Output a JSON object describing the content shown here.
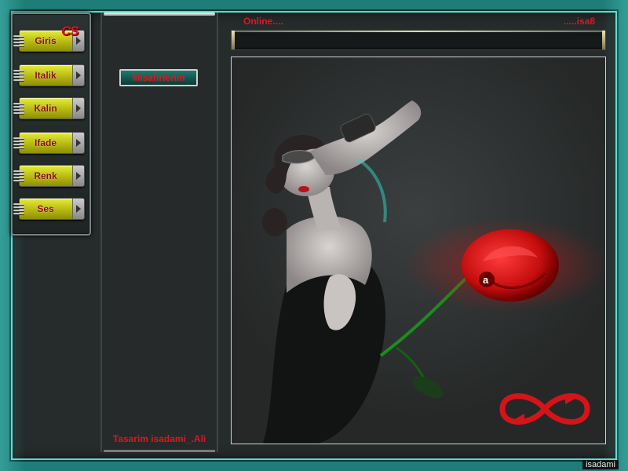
{
  "menu": {
    "logo": "CS",
    "items": [
      {
        "label": "Giris"
      },
      {
        "label": "Italik"
      },
      {
        "label": "Kalin"
      },
      {
        "label": "Ifade"
      },
      {
        "label": "Renk"
      },
      {
        "label": "Ses"
      }
    ]
  },
  "middle": {
    "guest_button": "Misafirlerim",
    "credit": "Tasarim isadami_.Ali"
  },
  "header": {
    "online_label": "Online....",
    "right_label": ".....isa8"
  },
  "photo": {
    "rose_letter": "a"
  },
  "footer": {
    "watermark": "isadami"
  },
  "colors": {
    "frame": "#1e7d78",
    "accent_red": "#e01520",
    "button_yellow": "#cfd41f"
  }
}
